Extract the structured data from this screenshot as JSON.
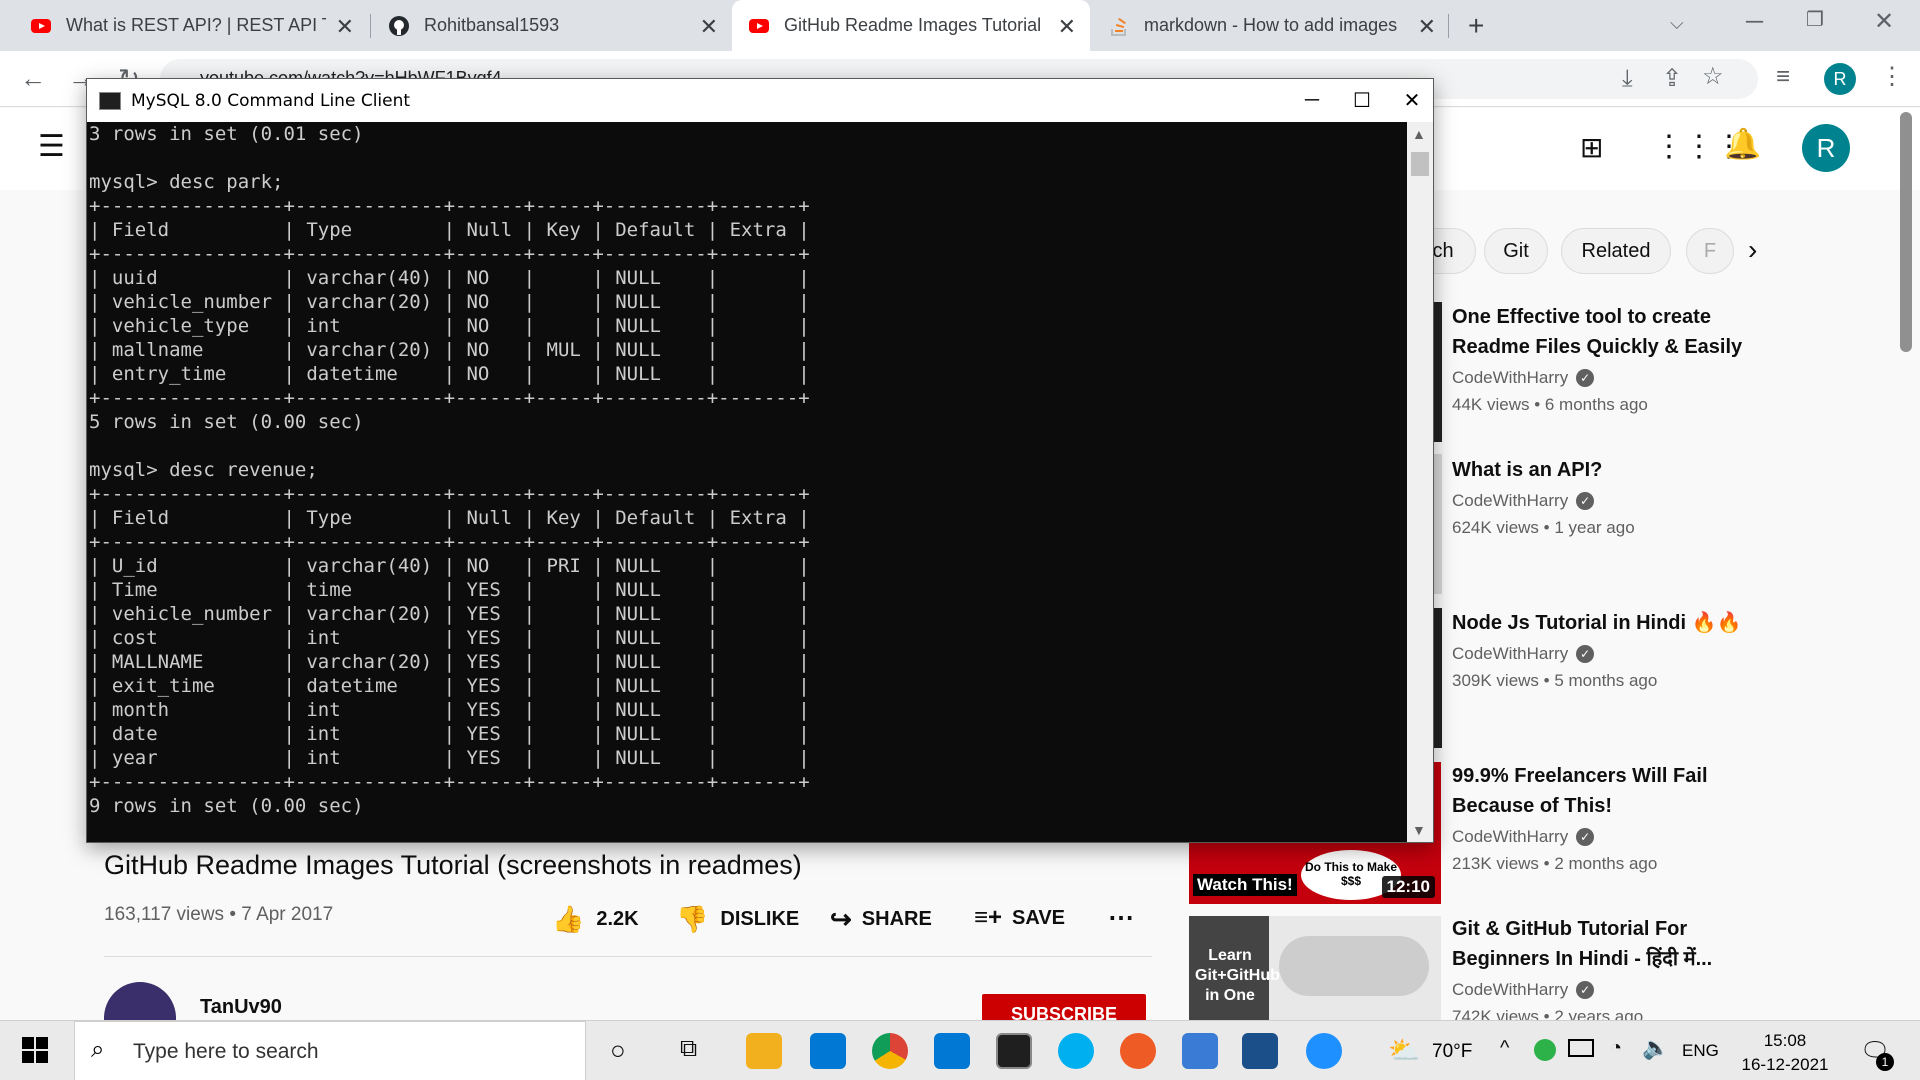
{
  "browser": {
    "tabs": [
      {
        "title": "What is REST API? | REST API Tuto",
        "favicon": "youtube-icon"
      },
      {
        "title": "Rohitbansal1593",
        "favicon": "github-icon"
      },
      {
        "title": "GitHub Readme Images Tutorial (",
        "favicon": "youtube-icon"
      },
      {
        "title": "markdown - How to add images",
        "favicon": "stackoverflow-icon"
      }
    ],
    "new_tab": "+",
    "url": "youtube.com/watch?v=hHbWF1Bvgf4",
    "profile_initial": "R"
  },
  "youtube": {
    "avatar_initial": "R",
    "chips": [
      "ch",
      "Git",
      "Related",
      "F"
    ],
    "video_title": "GitHub Readme Images Tutorial (screenshots in readmes)",
    "views_date": "163,117 views • 7 Apr 2017",
    "actions": {
      "like": "2.2K",
      "dislike": "DISLIKE",
      "share": "SHARE",
      "save": "SAVE"
    },
    "channel": "TanUv90",
    "subscribe": "SUBSCRIBE",
    "recommendations": [
      {
        "title_1": "One Effective tool to create",
        "title_2": "Readme Files Quickly & Easily",
        "channel": "CodeWithHarry",
        "meta": "44K views • 6 months ago"
      },
      {
        "title_1": "What is an API?",
        "title_2": "",
        "channel": "CodeWithHarry",
        "meta": "624K views • 1 year ago"
      },
      {
        "title_1": "Node Js Tutorial in Hindi 🔥🔥",
        "title_2": "",
        "channel": "CodeWithHarry",
        "meta": "309K views • 5 months ago"
      },
      {
        "title_1": "99.9% Freelancers Will Fail",
        "title_2": "Because of This!",
        "channel": "CodeWithHarry",
        "meta": "213K views • 2 months ago"
      },
      {
        "title_1": "Git & GitHub Tutorial For",
        "title_2": "Beginners In Hindi - हिंदी में...",
        "channel": "CodeWithHarry",
        "meta": "742K views • 2 years ago"
      }
    ],
    "thumb_text": {
      "watch": "Watch This!",
      "dothis": "Do This to Make $$$",
      "duration": "12:10",
      "learn_1": "Learn",
      "learn_2": "Git+GitHub",
      "learn_3": "in One"
    }
  },
  "mysql": {
    "window_title": "MySQL 8.0 Command Line Client",
    "console_text": "3 rows in set (0.01 sec)\n\nmysql> desc park;\n+----------------+-------------+------+-----+---------+-------+\n| Field          | Type        | Null | Key | Default | Extra |\n+----------------+-------------+------+-----+---------+-------+\n| uuid           | varchar(40) | NO   |     | NULL    |       |\n| vehicle_number | varchar(20) | NO   |     | NULL    |       |\n| vehicle_type   | int         | NO   |     | NULL    |       |\n| mallname       | varchar(20) | NO   | MUL | NULL    |       |\n| entry_time     | datetime    | NO   |     | NULL    |       |\n+----------------+-------------+------+-----+---------+-------+\n5 rows in set (0.00 sec)\n\nmysql> desc revenue;\n+----------------+-------------+------+-----+---------+-------+\n| Field          | Type        | Null | Key | Default | Extra |\n+----------------+-------------+------+-----+---------+-------+\n| U_id           | varchar(40) | NO   | PRI | NULL    |       |\n| Time           | time        | YES  |     | NULL    |       |\n| vehicle_number | varchar(20) | YES  |     | NULL    |       |\n| cost           | int         | YES  |     | NULL    |       |\n| MALLNAME       | varchar(20) | YES  |     | NULL    |       |\n| exit_time      | datetime    | YES  |     | NULL    |       |\n| month          | int         | YES  |     | NULL    |       |\n| date           | int         | YES  |     | NULL    |       |\n| year           | int         | YES  |     | NULL    |       |\n+----------------+-------------+------+-----+---------+-------+\n9 rows in set (0.00 sec)"
  },
  "taskbar": {
    "search_placeholder": "Type here to search",
    "weather": "70°F",
    "lang": "ENG",
    "time": "15:08",
    "date": "16-12-2021",
    "notification_count": "1"
  },
  "colors": {
    "yt_red": "#ff0000",
    "accent_teal": "#00838f",
    "console_bg": "#0c0c0c",
    "console_fg": "#cccccc"
  }
}
